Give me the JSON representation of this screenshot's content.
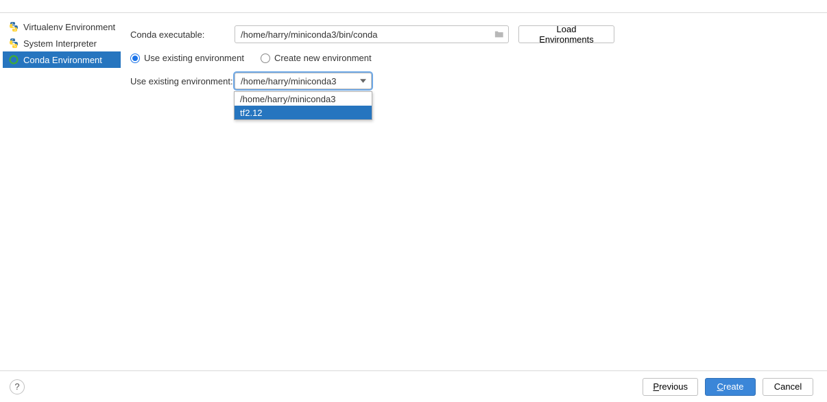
{
  "sidebar": {
    "items": [
      {
        "label": "Virtualenv Environment",
        "selected": false
      },
      {
        "label": "System Interpreter",
        "selected": false
      },
      {
        "label": "Conda Environment",
        "selected": true
      }
    ]
  },
  "form": {
    "conda_exe_label": "Conda executable:",
    "conda_exe_value": "/home/harry/miniconda3/bin/conda",
    "load_btn": "Load Environments",
    "radio_use_existing": "Use existing environment",
    "radio_create_new": "Create new environment",
    "env_label": "Use existing environment:",
    "env_selected": "/home/harry/miniconda3",
    "env_options": [
      {
        "label": "/home/harry/miniconda3",
        "highlight": false
      },
      {
        "label": "tf2.12",
        "highlight": true
      }
    ]
  },
  "footer": {
    "help": "?",
    "previous_mnemonic": "P",
    "previous_rest": "revious",
    "create_mnemonic": "C",
    "create_rest": "reate",
    "cancel": "Cancel"
  }
}
